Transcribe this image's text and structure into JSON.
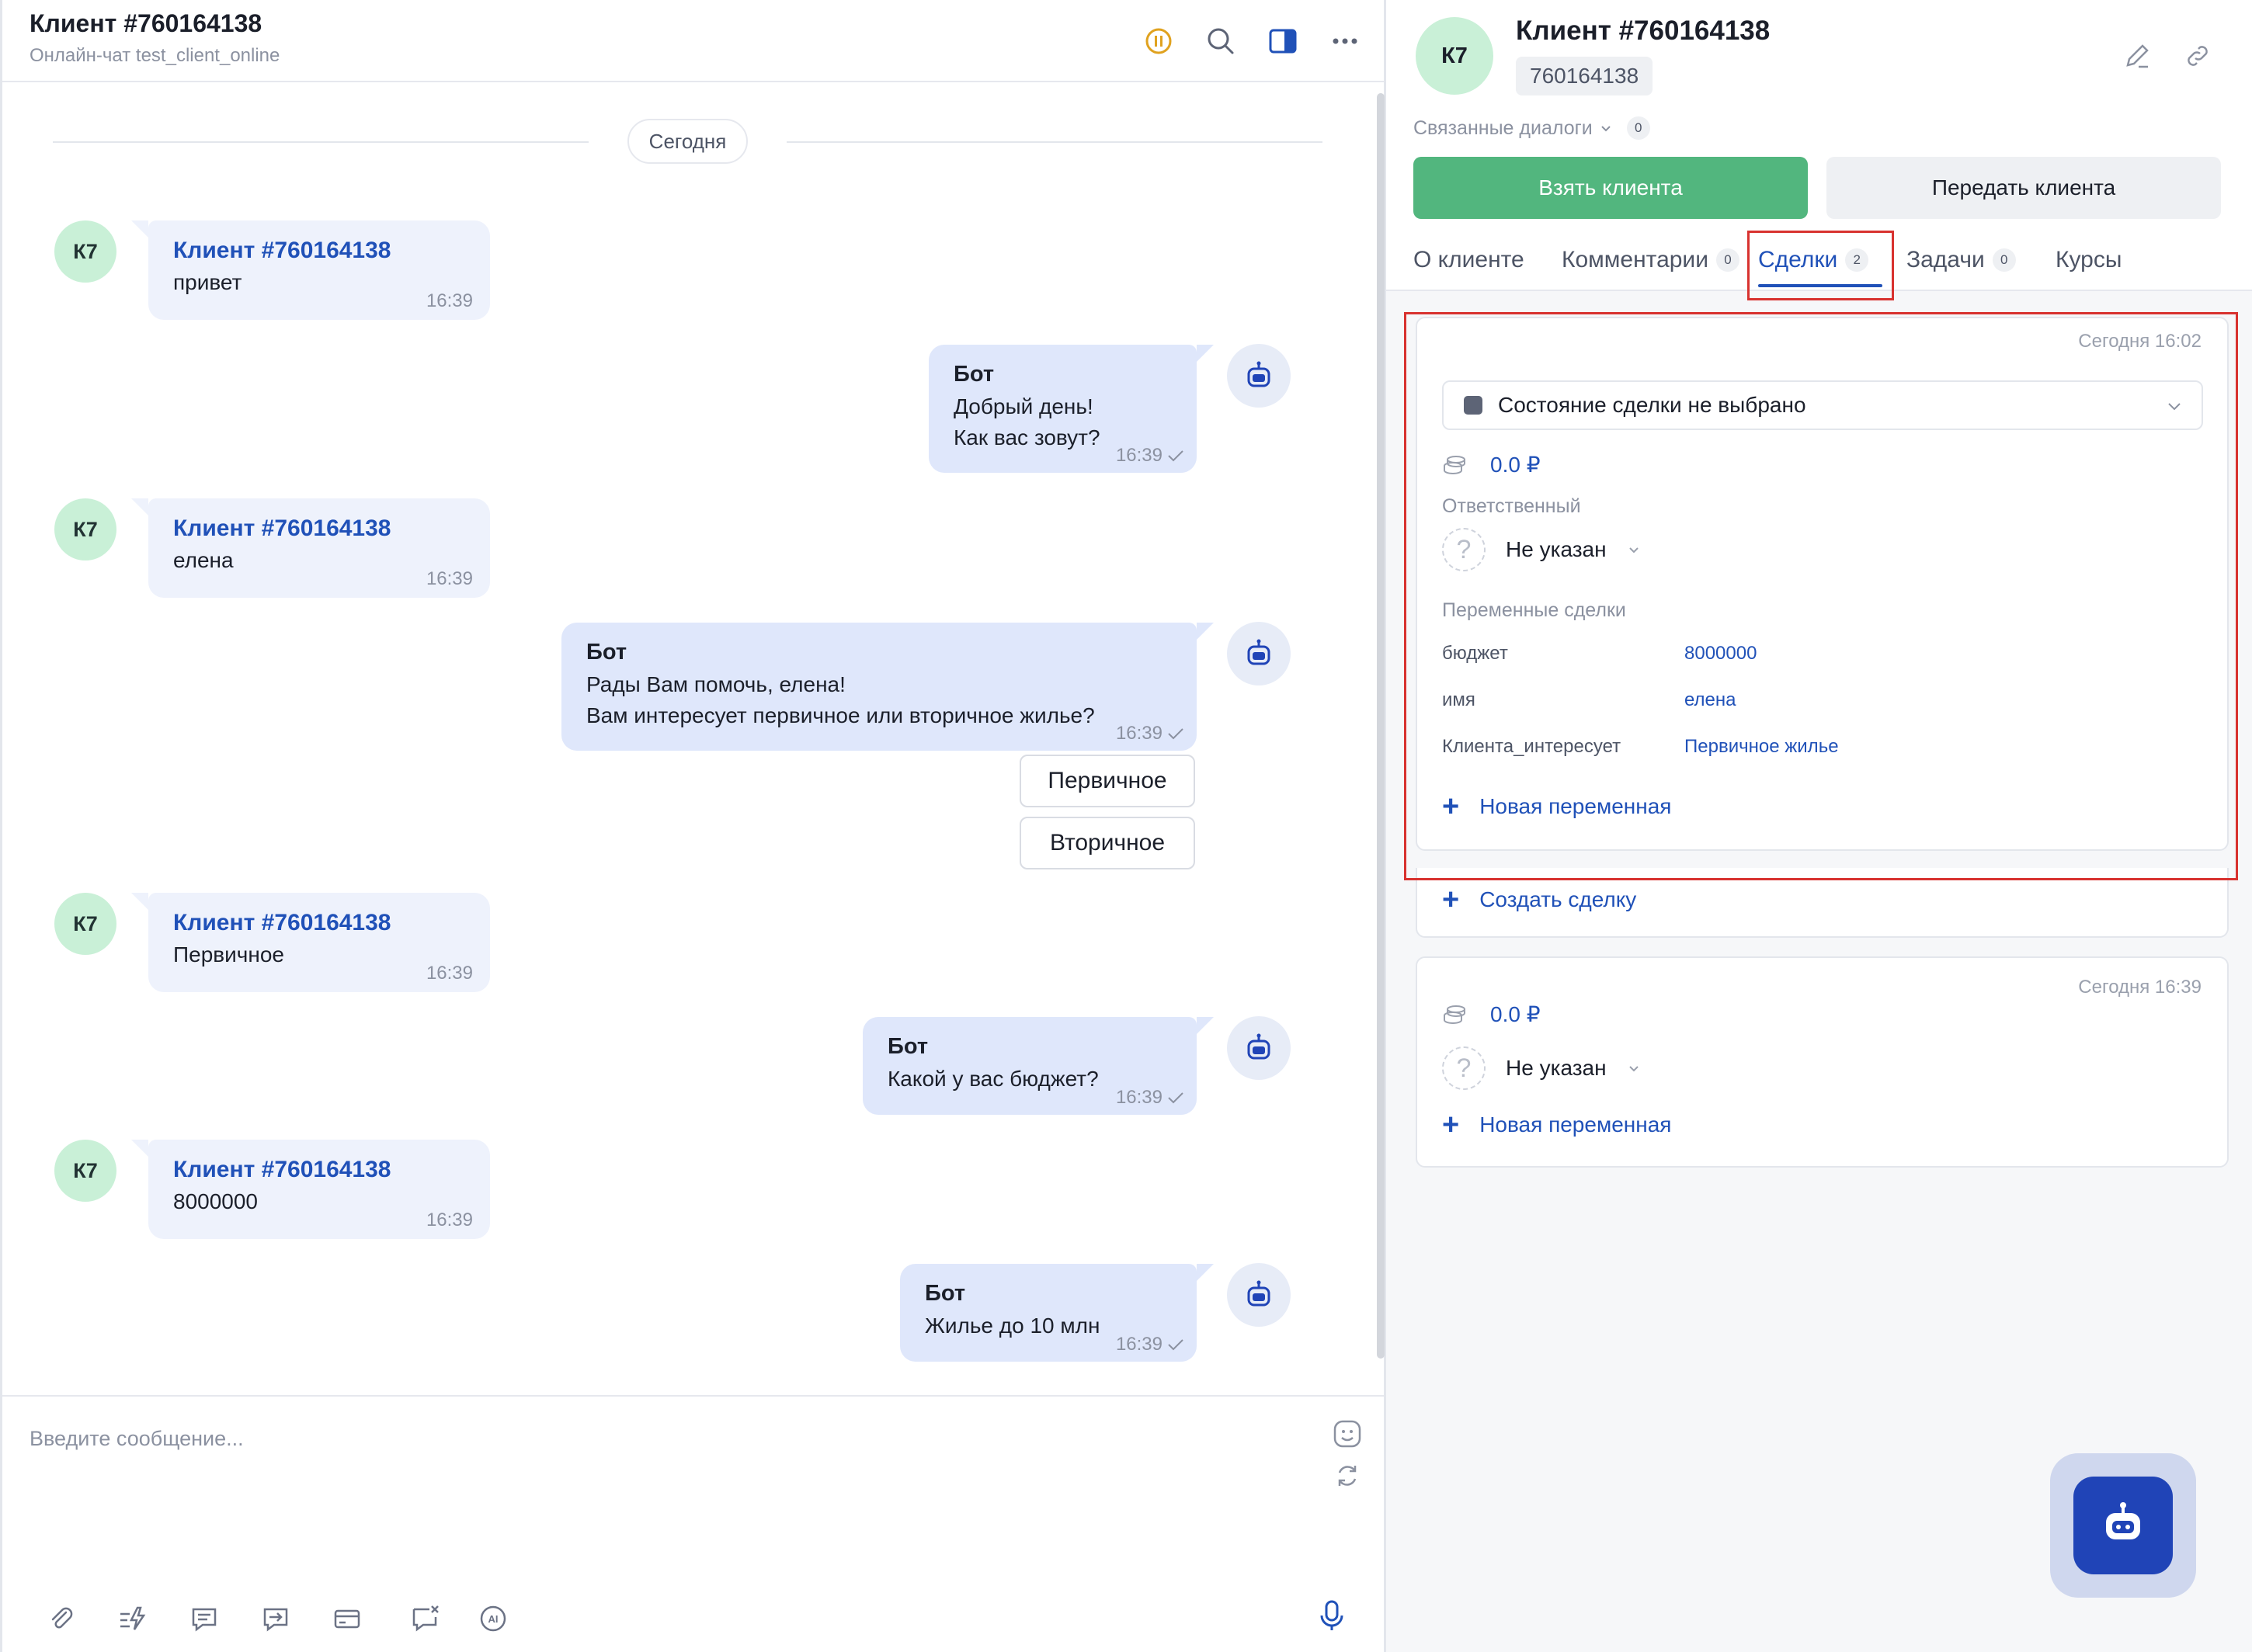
{
  "chat": {
    "title": "Клиент #760164138",
    "subtitle": "Онлайн-чат test_client_online",
    "date_divider": "Сегодня",
    "client_initials": "К7",
    "messages": [
      {
        "from": "client",
        "name": "Клиент #760164138",
        "lines": [
          "привет"
        ],
        "time": "16:39"
      },
      {
        "from": "bot",
        "name": "Бот",
        "lines": [
          "Добрый день!",
          "Как вас зовут?"
        ],
        "time": "16:39"
      },
      {
        "from": "client",
        "name": "Клиент #760164138",
        "lines": [
          "елена"
        ],
        "time": "16:39"
      },
      {
        "from": "bot",
        "name": "Бот",
        "lines": [
          "Рады Вам помочь, елена!",
          "Вам интересует первичное или вторичное жилье?"
        ],
        "time": "16:39"
      },
      {
        "from": "client",
        "name": "Клиент #760164138",
        "lines": [
          "Первичное"
        ],
        "time": "16:39"
      },
      {
        "from": "bot",
        "name": "Бот",
        "lines": [
          "Какой у вас бюджет?"
        ],
        "time": "16:39"
      },
      {
        "from": "client",
        "name": "Клиент #760164138",
        "lines": [
          "8000000"
        ],
        "time": "16:39"
      },
      {
        "from": "bot",
        "name": "Бот",
        "lines": [
          "Жилье до 10 млн"
        ],
        "time": "16:39"
      }
    ],
    "quick_replies": [
      "Первичное",
      "Вторичное"
    ],
    "composer_placeholder": "Введите сообщение..."
  },
  "client": {
    "initials": "К7",
    "name": "Клиент #760164138",
    "id": "760164138",
    "related_label": "Связанные диалоги",
    "related_count": "0",
    "take_button": "Взять клиента",
    "transfer_button": "Передать клиента",
    "tabs": [
      {
        "label": "О клиенте",
        "count": ""
      },
      {
        "label": "Комментарии",
        "count": "0"
      },
      {
        "label": "Сделки",
        "count": "2"
      },
      {
        "label": "Задачи",
        "count": "0"
      },
      {
        "label": "Курсы",
        "count": ""
      }
    ]
  },
  "deals": {
    "deal1": {
      "date": "Сегодня 16:02",
      "state": "Состояние сделки не выбрано",
      "amount": "0.0 ₽",
      "responsible_label": "Ответственный",
      "responsible_value": "Не указан",
      "variables_label": "Переменные сделки",
      "variables": [
        {
          "key": "бюджет",
          "value": "8000000"
        },
        {
          "key": "имя",
          "value": "елена"
        },
        {
          "key": "Клиента_интересует",
          "value": "Первичное жилье"
        }
      ],
      "add_variable": "Новая переменная"
    },
    "create_deal": "Создать сделку",
    "deal2": {
      "date": "Сегодня 16:39",
      "amount": "0.0 ₽",
      "responsible_value": "Не указан",
      "add_variable": "Новая переменная"
    }
  },
  "colors": {
    "accent": "#2051b8",
    "take_button": "#52b67e",
    "highlight": "#d8322f",
    "client_avatar": "#c9f0d7",
    "bot_bubble": "#dfe7fb",
    "client_bubble": "#eef2fc"
  }
}
